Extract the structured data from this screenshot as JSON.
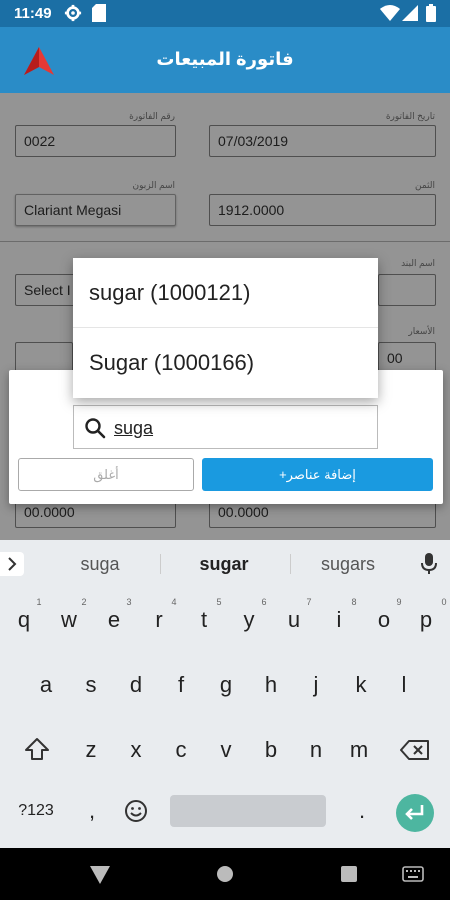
{
  "status_bar": {
    "time": "11:49"
  },
  "app_bar": {
    "title": "فاتورة  المبيعات",
    "brand_color": "#2a8cc7"
  },
  "form": {
    "invoice_number_label": "رقم الفاتورة",
    "invoice_number": "0022",
    "invoice_date_label": "تاريخ الفاتورة",
    "invoice_date": "07/03/2019",
    "customer_name_label": "اسم الزبون",
    "customer_name": "Clariant Megasi",
    "price_total_label": "الثمن",
    "price_total": "1912.0000",
    "item_name_label": "اسم البند",
    "item_select_placeholder": "Select I",
    "prices_label": "الأسعار",
    "price_value_partial": "00",
    "bottom_left_value": "00.0000",
    "bottom_right_value": "00.0000"
  },
  "dialog": {
    "search_value": "suga",
    "close_label": "أغلق",
    "add_label": "+إضافة عناصر"
  },
  "dropdown": {
    "items": [
      "sugar (1000121)",
      "Sugar (1000166)"
    ]
  },
  "keyboard": {
    "suggestions": [
      "suga",
      "sugar",
      "sugars"
    ],
    "row1": [
      "q",
      "w",
      "e",
      "r",
      "t",
      "y",
      "u",
      "i",
      "o",
      "p"
    ],
    "row1_numbers": [
      "1",
      "2",
      "3",
      "4",
      "5",
      "6",
      "7",
      "8",
      "9",
      "0"
    ],
    "row2": [
      "a",
      "s",
      "d",
      "f",
      "g",
      "h",
      "j",
      "k",
      "l"
    ],
    "row3": [
      "z",
      "x",
      "c",
      "v",
      "b",
      "n",
      "m"
    ],
    "symbols_label": "?123",
    "comma": ",",
    "period": ".",
    "accent_color": "#4db6a0"
  }
}
